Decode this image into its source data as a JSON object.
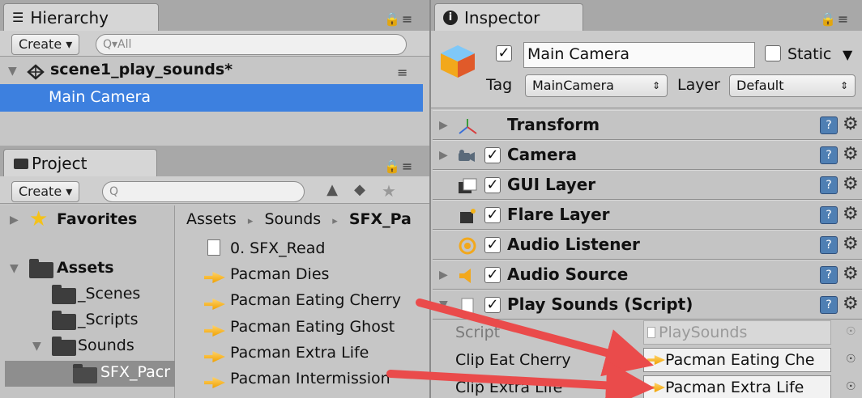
{
  "hierarchy": {
    "tab_title": "Hierarchy",
    "create_label": "Create ▾",
    "search_placeholder": "Q▾All",
    "scene_name": "scene1_play_sounds*",
    "selected_item": "Main Camera"
  },
  "project": {
    "tab_title": "Project",
    "create_label": "Create ▾",
    "search_placeholder": "Q",
    "favorites_label": "Favorites",
    "assets_label": "Assets",
    "folders": [
      "_Scenes",
      "_Scripts",
      "Sounds"
    ],
    "selected_subfolder": "SFX_Pacr",
    "breadcrumb": [
      "Assets",
      "Sounds",
      "SFX_Pa"
    ],
    "breadcrumb_sep": "▸",
    "files": [
      "0. SFX_Read",
      "Pacman Dies",
      "Pacman Eating Cherry",
      "Pacman Eating Ghost",
      "Pacman Extra Life",
      "Pacman Intermission"
    ]
  },
  "inspector": {
    "tab_title": "Inspector",
    "object_name": "Main Camera",
    "static_label": "Static",
    "tag_label": "Tag",
    "tag_value": "MainCamera",
    "layer_label": "Layer",
    "layer_value": "Default",
    "components": [
      "Transform",
      "Camera",
      "GUI Layer",
      "Flare Layer",
      "Audio Listener",
      "Audio Source",
      "Play Sounds (Script)"
    ],
    "fields": {
      "script_label": "Script",
      "script_value": "PlaySounds",
      "clip_eat_cherry_label": "Clip Eat Cherry",
      "clip_eat_cherry_value": "Pacman Eating Che",
      "clip_extra_life_label": "Clip Extra Life",
      "clip_extra_life_value": "Pacman Extra Life"
    }
  },
  "colors": {
    "selection": "#3d80df",
    "arrow": "#ea4b4b",
    "audio_icon": "#f5b01a"
  }
}
